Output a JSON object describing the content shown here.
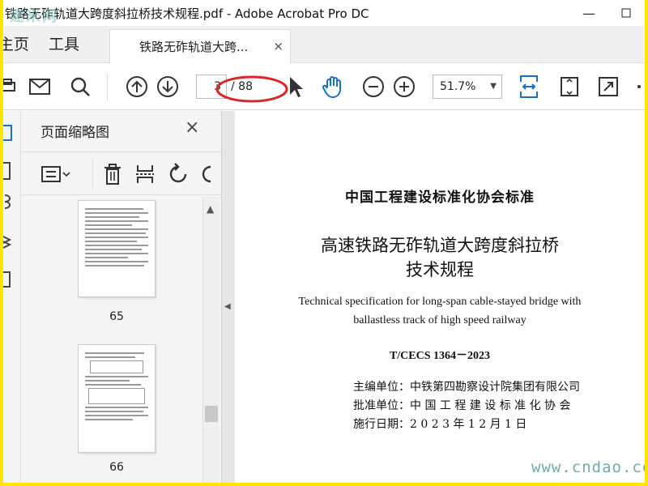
{
  "window": {
    "title": "铁路无砟轨道大跨度斜拉桥技术规程.pdf - Adobe Acrobat Pro DC",
    "controls": [
      "minimize",
      "maximize",
      "close"
    ]
  },
  "watermark": {
    "top": "建米网",
    "bottom": "www.cndao.com"
  },
  "tabs": {
    "home": "主页",
    "tools": "工具",
    "document": "铁路无砟轨道大跨...",
    "document_close": "×"
  },
  "toolbar": {
    "icons": [
      "print-icon",
      "mail-icon",
      "search-icon",
      "page-up-icon",
      "page-down-icon",
      "select-cursor-icon",
      "hand-icon",
      "zoom-out-icon",
      "zoom-in-icon",
      "fit-width-icon",
      "fit-page-icon",
      "fullscreen-icon"
    ],
    "current_page": "3",
    "total_pages": "/ 88",
    "zoom": "51.7%",
    "highlight_color": "#d9262b"
  },
  "thumbnails": {
    "title": "页面缩略图",
    "close": "×",
    "pages": [
      {
        "number": "65"
      },
      {
        "number": "66"
      }
    ]
  },
  "document": {
    "standard": "中国工程建设标准化协会标准",
    "title_line1": "高速铁路无砟轨道大跨度斜拉桥",
    "title_line2": "技术规程",
    "english_line1": "Technical specification for long-span cable-stayed bridge with",
    "english_line2": "ballastless track of high speed railway",
    "code": "T/CECS 1364－2023",
    "editor": "主编单位：中铁第四勘察设计院集团有限公司",
    "approver": "批准单位：中 国 工 程 建 设 标 准 化 协 会",
    "effective": "施行日期：2  0  2  3  年  1  2  月  1  日"
  }
}
